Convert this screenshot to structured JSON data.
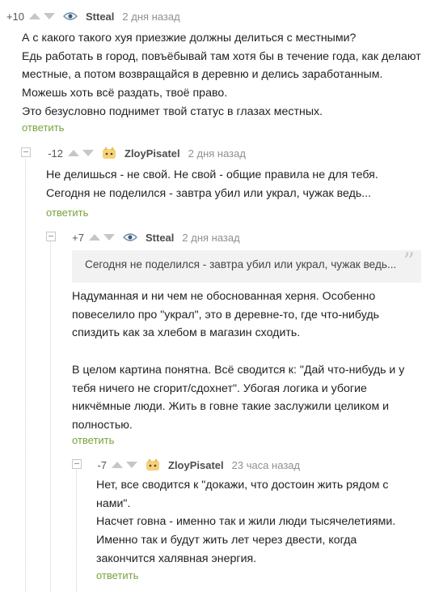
{
  "comments": [
    {
      "rating": "+10",
      "author": "Stteal",
      "time": "2 дня назад",
      "lines": [
        "А с какого такого хуя приезжие должны делиться с местными?",
        "Едь работать в город, повъёбывай там хотя бы в течение года, как делают",
        "местные, а потом возвращайся в деревню и делись заработанным.",
        "Можешь хоть всё раздать, твоё право.",
        "Это безусловно поднимет твой статус в глазах местных."
      ],
      "reply": "ответить"
    },
    {
      "rating": "-12",
      "author": "ZloyPisatel",
      "time": "2 дня назад",
      "lines": [
        "Не делишься - не свой. Не свой - общие правила не для тебя.",
        "Сегодня не поделился - завтра убил или украл, чужак ведь..."
      ],
      "reply": "ответить"
    },
    {
      "rating": "+7",
      "author": "Stteal",
      "time": "2 дня назад",
      "quote": "Сегодня не поделился - завтра убил или украл, чужак ведь...",
      "lines": [
        "Надуманная и ни чем не обоснованная херня. Особенно",
        "повеселило про \"украл\", это в деревне-то, где что-нибудь",
        "спиздить как за хлебом в магазин сходить.",
        "",
        "В целом картина понятна. Всё сводится к: \"Дай что-нибудь и у",
        "тебя ничего не сгорит/сдохнет\". Убогая логика и убогие",
        "никчёмные люди. Жить в говне такие заслужили целиком и",
        "полностью."
      ],
      "reply": "ответить"
    },
    {
      "rating": "-7",
      "author": "ZloyPisatel",
      "time": "23 часа назад",
      "lines": [
        "Нет, все сводится к \"докажи, что достоин жить рядом с",
        "нами\".",
        "Насчет говна - именно так и жили люди тысячелетиями.",
        "Именно так и будут жить лет через двести, когда",
        "закончится халявная энергия."
      ],
      "reply": "ответить"
    }
  ]
}
